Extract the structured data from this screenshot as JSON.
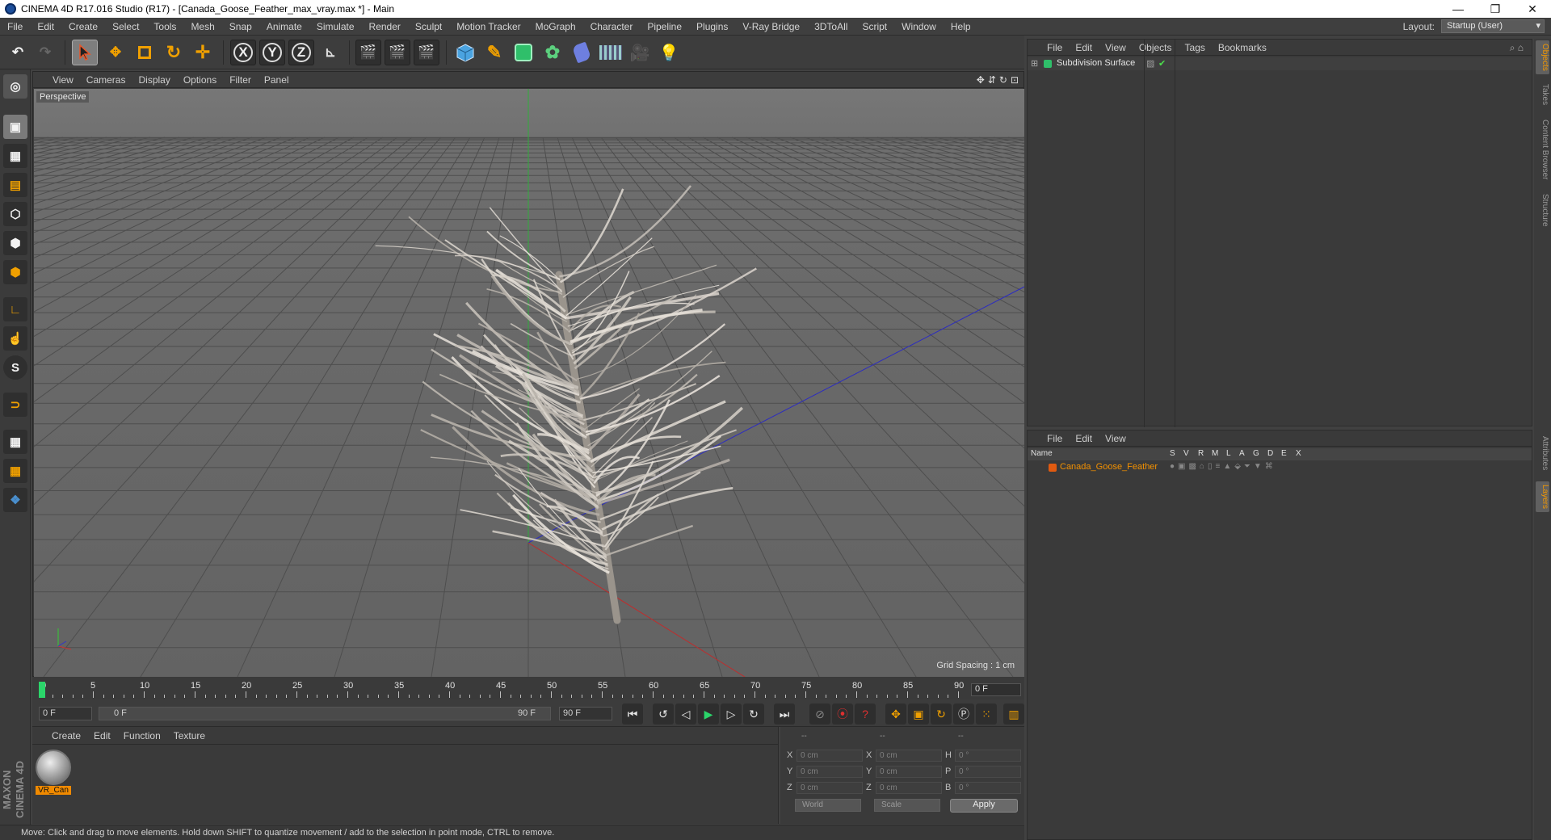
{
  "window": {
    "title": "CINEMA 4D R17.016 Studio (R17) - [Canada_Goose_Feather_max_vray.max *] - Main",
    "min": "—",
    "restore": "❐",
    "close": "✕"
  },
  "menu": [
    "File",
    "Edit",
    "Create",
    "Select",
    "Tools",
    "Mesh",
    "Snap",
    "Animate",
    "Simulate",
    "Render",
    "Sculpt",
    "Motion Tracker",
    "MoGraph",
    "Character",
    "Pipeline",
    "Plugins",
    "V-Ray Bridge",
    "3DToAll",
    "Script",
    "Window",
    "Help"
  ],
  "layout": {
    "label": "Layout:",
    "value": "Startup (User)"
  },
  "toolbar": {
    "x": "X",
    "y": "Y",
    "z": "Z"
  },
  "viewport": {
    "menu": [
      "View",
      "Cameras",
      "Display",
      "Options",
      "Filter",
      "Panel"
    ],
    "label": "Perspective",
    "grid_spacing": "Grid Spacing : 1 cm"
  },
  "timeline": {
    "ticks": [
      "0",
      "5",
      "10",
      "15",
      "20",
      "25",
      "30",
      "35",
      "40",
      "45",
      "50",
      "55",
      "60",
      "65",
      "70",
      "75",
      "80",
      "85",
      "90"
    ],
    "frame_end": "0 F"
  },
  "transport": {
    "start": "0 F",
    "range_start": "0 F",
    "range_end": "90 F",
    "end": "90 F"
  },
  "material_manager": {
    "menu": [
      "Create",
      "Edit",
      "Function",
      "Texture"
    ],
    "material_name": "VR_Can"
  },
  "coordinates": {
    "headers": [
      "--",
      "--",
      "--"
    ],
    "rows": [
      {
        "a": "X",
        "av": "0 cm",
        "b": "X",
        "bv": "0 cm",
        "c": "H",
        "cv": "0 °"
      },
      {
        "a": "Y",
        "av": "0 cm",
        "b": "Y",
        "bv": "0 cm",
        "c": "P",
        "cv": "0 °"
      },
      {
        "a": "Z",
        "av": "0 cm",
        "b": "Z",
        "bv": "0 cm",
        "c": "B",
        "cv": "0 °"
      }
    ],
    "world": "World",
    "scale": "Scale",
    "apply": "Apply"
  },
  "status": "Move: Click and drag to move elements. Hold down SHIFT to quantize movement / add to the selection in point mode, CTRL to remove.",
  "object_manager": {
    "menu": [
      "File",
      "Edit",
      "View",
      "Objects",
      "Tags",
      "Bookmarks"
    ],
    "object": "Subdivision Surface"
  },
  "layer_manager": {
    "menu": [
      "File",
      "Edit",
      "View"
    ],
    "columns": [
      "Name",
      "S",
      "V",
      "R",
      "M",
      "L",
      "A",
      "G",
      "D",
      "E",
      "X"
    ],
    "layer": "Canada_Goose_Feather"
  },
  "right_tabs": [
    "Objects",
    "Takes",
    "Content Browser",
    "Structure",
    "Attributes",
    "Layers"
  ],
  "maxon": "MAXON CINEMA 4D"
}
